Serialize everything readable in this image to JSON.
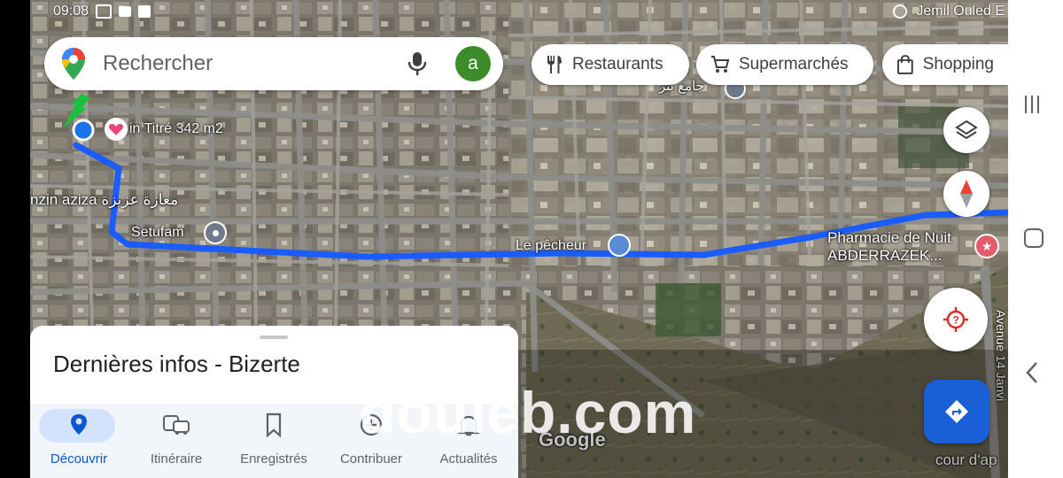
{
  "status_bar": {
    "time": "09:08",
    "right_text": "Jemil Ouled E"
  },
  "search": {
    "placeholder": "Rechercher",
    "avatar_letter": "a"
  },
  "chips": [
    {
      "label": "Restaurants",
      "icon": "restaurant-icon"
    },
    {
      "label": "Supermarchés",
      "icon": "cart-icon"
    },
    {
      "label": "Shopping",
      "icon": "shopping-bag-icon"
    }
  ],
  "map_labels": {
    "poi_titre": "in Titré 342 m2",
    "shop": "nzin aziza مغازة عزيزة",
    "setufam": "Setufam",
    "pecheur": "Le pêcheur",
    "pharmacy_line1": "Pharmacie de Nuit",
    "pharmacy_line2": "ABDERRAZEK...",
    "avenue": "Avenue 14 Janvi",
    "mosque": "جامع بئر",
    "google": "Google",
    "cour": "cour d'ap"
  },
  "sheet": {
    "title": "Dernières infos - Bizerte"
  },
  "bottom_nav": [
    {
      "label": "Découvrir",
      "icon": "pin-icon",
      "active": true
    },
    {
      "label": "Itinéraire",
      "icon": "commute-icon",
      "active": false
    },
    {
      "label": "Enregistrés",
      "icon": "bookmark-icon",
      "active": false
    },
    {
      "label": "Contribuer",
      "icon": "add-circle-icon",
      "active": false
    },
    {
      "label": "Actualités",
      "icon": "bell-icon",
      "active": false
    }
  ],
  "watermark": "douleb.com",
  "colors": {
    "route": "#1a5cff",
    "accent": "#1a73e8",
    "avatar": "#3c8c2a",
    "nav_active": "#d3e3fd",
    "directions_button": "#1a73e8"
  }
}
